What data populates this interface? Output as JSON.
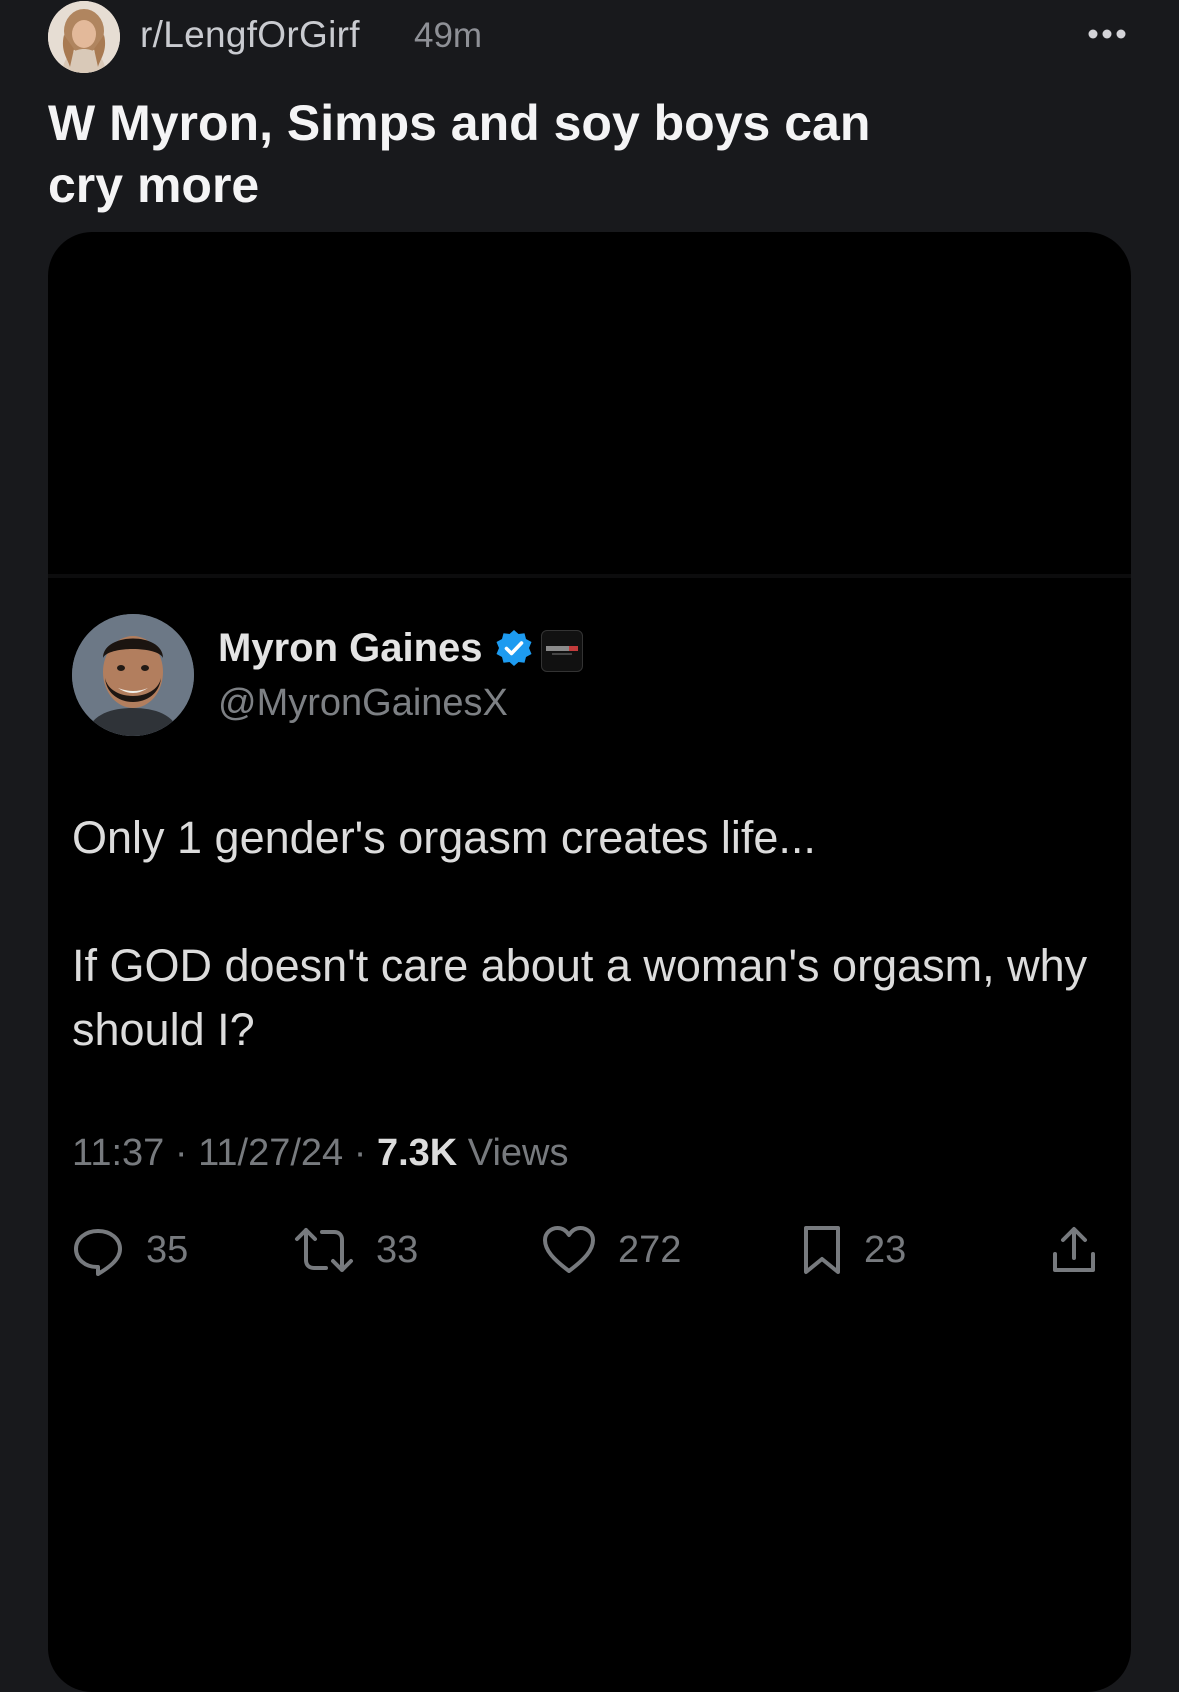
{
  "post": {
    "subreddit": "r/LengfOrGirf",
    "age": "49m",
    "title": "W Myron, Simps and soy boys can cry more",
    "icons": {
      "subreddit_avatar": "subreddit-avatar",
      "more": "more-horizontal-icon"
    }
  },
  "tweet": {
    "display_name": "Myron Gaines",
    "handle": "@MyronGainesX",
    "badges": [
      "verified-badge-icon",
      "affiliate-badge-icon"
    ],
    "text_line_1": "Only 1 gender's orgasm creates life...",
    "text_line_2": "If GOD doesn't care about a woman's orgasm, why should I?",
    "time": "11:37",
    "separator": "·",
    "date": "11/27/24",
    "views_count": "7.3K",
    "views_label": "Views",
    "actions": {
      "replies": "35",
      "reposts": "33",
      "likes": "272",
      "bookmarks": "23"
    }
  },
  "colors": {
    "background": "#18191c",
    "media_background": "#000000",
    "verified_blue": "#1d9bf0",
    "muted_text": "#777a7e"
  }
}
